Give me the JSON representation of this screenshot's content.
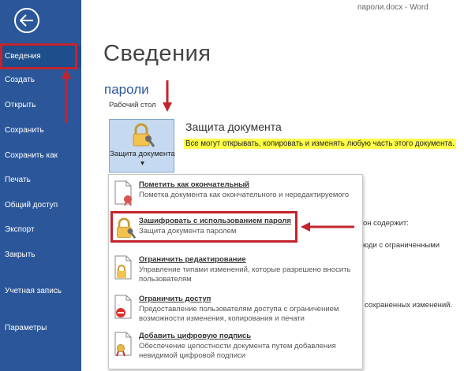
{
  "window": {
    "title": "пароли.docx - Word"
  },
  "sidebar": {
    "back_icon": "back-arrow-icon",
    "items": [
      {
        "label": "Сведения"
      },
      {
        "label": "Создать"
      },
      {
        "label": "Открыть"
      },
      {
        "label": "Сохранить"
      },
      {
        "label": "Сохранить как"
      },
      {
        "label": "Печать"
      },
      {
        "label": "Общий доступ"
      },
      {
        "label": "Экспорт"
      },
      {
        "label": "Закрыть"
      },
      {
        "label": "Учетная запись"
      },
      {
        "label": "Параметры"
      }
    ]
  },
  "main": {
    "title": "Сведения",
    "doc_name": "пароли",
    "doc_path": "Рабочий стол",
    "protect_button": {
      "label": "Защита документа",
      "icon": "lock-key-icon"
    },
    "protection": {
      "title": "Защита документа",
      "description": "Все могут открывать, копировать и изменять любую часть этого документа."
    },
    "background_text": [
      "он содержит:",
      "юди с ограниченными",
      "сохраненных изменений."
    ]
  },
  "menu": {
    "items": [
      {
        "title": "Пометить как окончательный",
        "desc": "Пометка документа как окончательного и нередактируемого",
        "icon": "document-final-icon"
      },
      {
        "title": "Зашифровать с использованием пароля",
        "desc": "Защита документа паролем",
        "icon": "lock-key-icon"
      },
      {
        "title": "Ограничить редактирование",
        "desc": "Управление типами изменений, которые разрешено вносить пользователям",
        "icon": "lock-document-icon"
      },
      {
        "title": "Ограничить доступ",
        "desc": "Предоставление пользователям доступа с ограничением возможности изменения, копирования и печати",
        "icon": "no-entry-document-icon"
      },
      {
        "title": "Добавить цифровую подпись",
        "desc": "Обеспечение целостности документа путем добавления невидимой цифровой подписи",
        "icon": "ribbon-document-icon"
      }
    ]
  },
  "colors": {
    "sidebar": "#2b579a",
    "accent": "#2b579a",
    "highlight": "#ffff4a",
    "annotation": "#c3242d"
  }
}
